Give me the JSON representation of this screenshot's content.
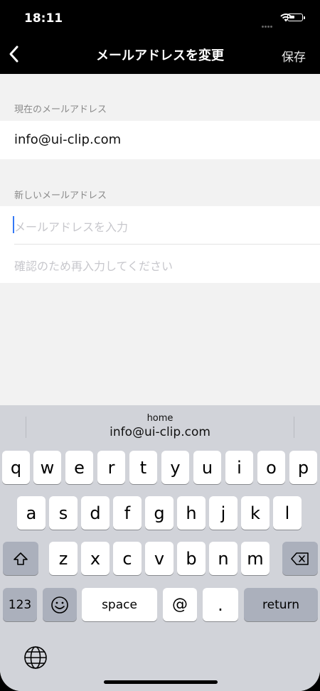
{
  "status_bar": {
    "time": "18:11"
  },
  "nav": {
    "back_label": "<",
    "title": "メールアドレスを変更",
    "save_label": "保存"
  },
  "current_email": {
    "label": "現在のメールアドレス",
    "value": "info@ui-clip.com"
  },
  "new_email": {
    "label": "新しいメールアドレス",
    "placeholder": "メールアドレスを入力",
    "confirm_placeholder": "確認のため再入力してください"
  },
  "keyboard": {
    "suggestion_label": "home",
    "suggestion_value": "info@ui-clip.com",
    "row1": [
      "q",
      "w",
      "e",
      "r",
      "t",
      "y",
      "u",
      "i",
      "o",
      "p"
    ],
    "row2": [
      "a",
      "s",
      "d",
      "f",
      "g",
      "h",
      "j",
      "k",
      "l"
    ],
    "row3": [
      "z",
      "x",
      "c",
      "v",
      "b",
      "n",
      "m"
    ],
    "numbers_label": "123",
    "space_label": "space",
    "at_label": "@",
    "dot_label": ".",
    "return_label": "return"
  },
  "colors": {
    "caret": "#3478f6",
    "header_bg": "#000000",
    "keyboard_bg": "#d1d3d9"
  }
}
